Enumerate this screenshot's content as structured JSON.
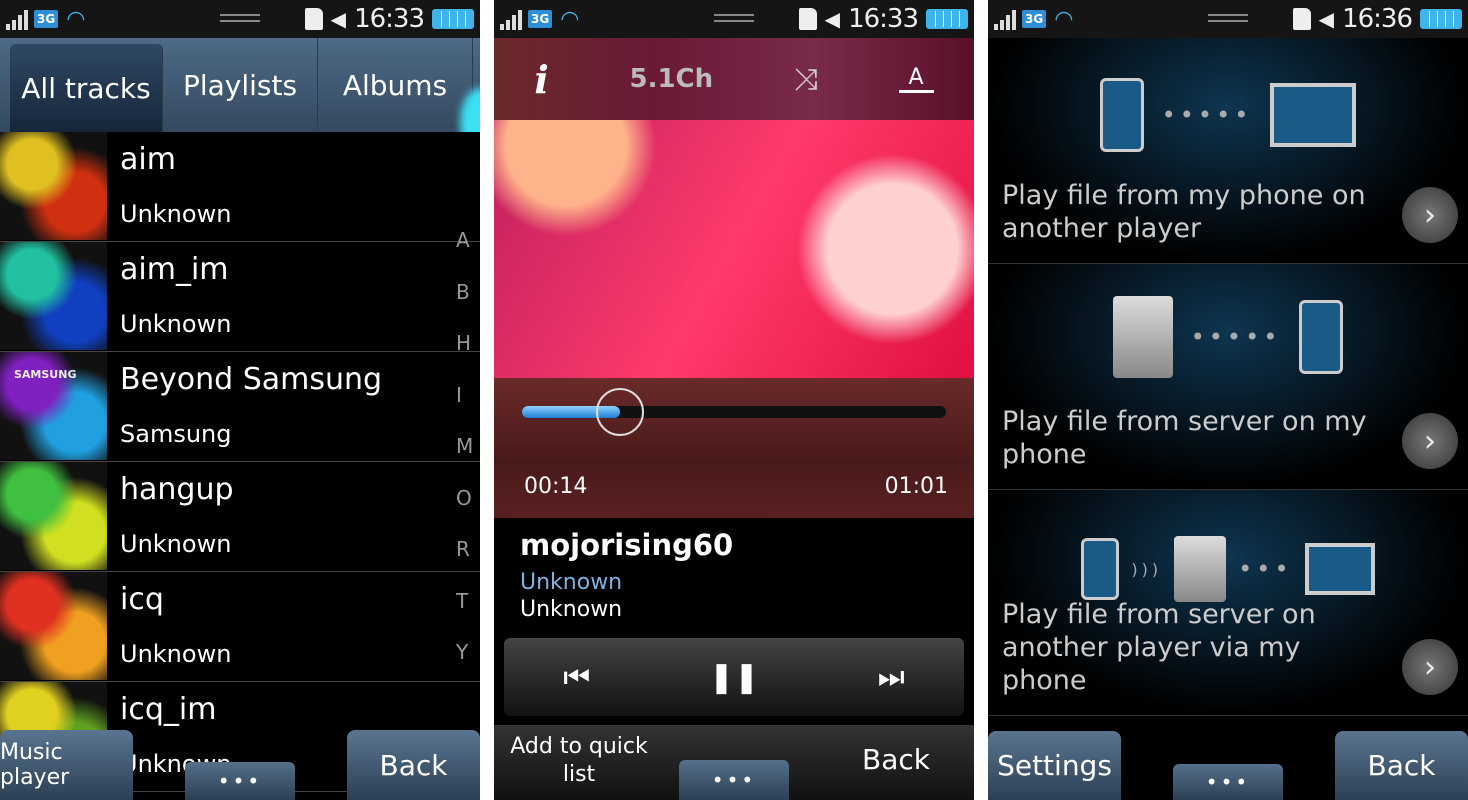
{
  "status_bars": [
    {
      "time": "16:33",
      "network": "3G"
    },
    {
      "time": "16:33",
      "network": "3G"
    },
    {
      "time": "16:36",
      "network": "3G"
    }
  ],
  "screen1": {
    "tabs": [
      "All tracks",
      "Playlists",
      "Albums"
    ],
    "tracks": [
      {
        "title": "aim",
        "artist": "Unknown",
        "colors": [
          "#e0c020",
          "#d03010"
        ]
      },
      {
        "title": "aim_im",
        "artist": "Unknown",
        "colors": [
          "#20c0a0",
          "#1040c0"
        ]
      },
      {
        "title": "Beyond Samsung",
        "artist": "Samsung",
        "colors": [
          "#8020c0",
          "#20a0e0"
        ],
        "logo": "SAMSUNG"
      },
      {
        "title": "hangup",
        "artist": "Unknown",
        "colors": [
          "#40c040",
          "#d0e020"
        ]
      },
      {
        "title": "icq",
        "artist": "Unknown",
        "colors": [
          "#e03020",
          "#f0a020"
        ]
      },
      {
        "title": "icq_im",
        "artist": "Unknown",
        "colors": [
          "#e0d020",
          "#60a020"
        ]
      }
    ],
    "index": [
      "A",
      "B",
      "H",
      "I",
      "M",
      "O",
      "R",
      "T",
      "Y"
    ],
    "buttons": {
      "left": "Music player",
      "more": "•••",
      "back": "Back"
    }
  },
  "screen2": {
    "toolbar": {
      "info_icon": "i",
      "surround": "5.1Ch",
      "shuffle_icon": "⤨",
      "repeat": "A"
    },
    "progress": {
      "elapsed": "00:14",
      "total": "01:01",
      "fraction": 0.23
    },
    "track": {
      "title": "mojorising60",
      "artist": "Unknown",
      "album": "Unknown"
    },
    "controls": {
      "prev": "⏮",
      "pause": "❚❚",
      "next": "⏭"
    },
    "buttons": {
      "left": "Add to quick list",
      "more": "•••",
      "back": "Back"
    },
    "accent": "#7fb2e0"
  },
  "screen3": {
    "items": [
      {
        "label": "Play file from my phone on another player"
      },
      {
        "label": "Play file from server on my phone"
      },
      {
        "label": "Play file from server on another player via my phone"
      }
    ],
    "buttons": {
      "left": "Settings",
      "more": "•••",
      "back": "Back"
    }
  }
}
